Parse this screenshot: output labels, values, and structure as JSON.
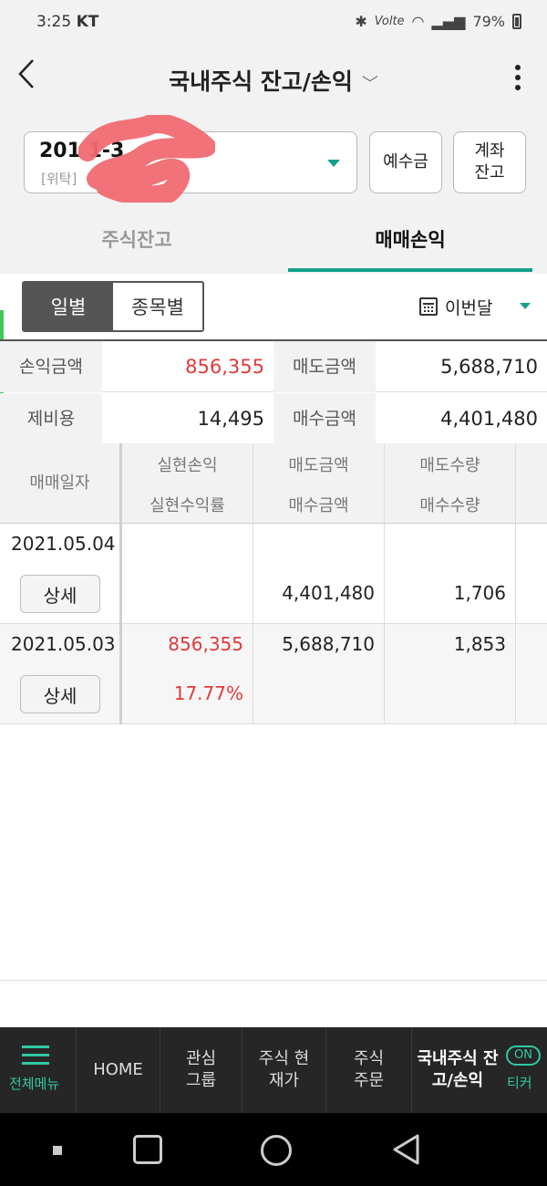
{
  "status_bar": {
    "time": "3:25",
    "carrier": "KT",
    "indicators": "Volte",
    "battery": "79%"
  },
  "header": {
    "title": "국내주식 잔고/손익",
    "title_chevron": "﹀"
  },
  "account": {
    "number": "201 1-3",
    "type": "[위탁]"
  },
  "buttons": {
    "deposit": "예수금",
    "account_balance": "계좌 잔고"
  },
  "tabs": [
    {
      "label": "주식잔고"
    },
    {
      "label": "매매손익"
    }
  ],
  "view_toggle": {
    "daily": "일별",
    "by_stock": "종목별"
  },
  "period": {
    "label": "이번달"
  },
  "summary": {
    "pnl_label": "손익금액",
    "pnl_value": "856,355",
    "sell_label": "매도금액",
    "sell_value": "5,688,710",
    "fee_label": "제비용",
    "fee_value": "14,495",
    "buy_label": "매수금액",
    "buy_value": "4,401,480"
  },
  "table": {
    "headers": {
      "date": "매매일자",
      "pnl_1": "실현손익",
      "pnl_2": "실현수익률",
      "amt_1": "매도금액",
      "amt_2": "매수금액",
      "qty_1": "매도수량",
      "qty_2": "매수수량"
    },
    "rows": [
      {
        "date": "2021.05.04",
        "detail": "상세",
        "pnl": "",
        "rate": "",
        "sell_amt": "",
        "buy_amt": "4,401,480",
        "sell_qty": "",
        "buy_qty": "1,706"
      },
      {
        "date": "2021.05.03",
        "detail": "상세",
        "pnl": "856,355",
        "rate": "17.77%",
        "sell_amt": "5,688,710",
        "buy_amt": "",
        "sell_qty": "1,853",
        "buy_qty": ""
      }
    ]
  },
  "bottom_nav": {
    "menu": "전체메뉴",
    "home": "HOME",
    "watch": "관심 그룹",
    "quote": "주식 현재가",
    "order": "주식 주문",
    "current": "국내주식 잔고/손익",
    "ticker_on": "ON",
    "ticker": "티커"
  },
  "colors": {
    "accent": "#14a08a",
    "loss_profit_red": "#e03a3a",
    "nav_bg": "#262626"
  }
}
